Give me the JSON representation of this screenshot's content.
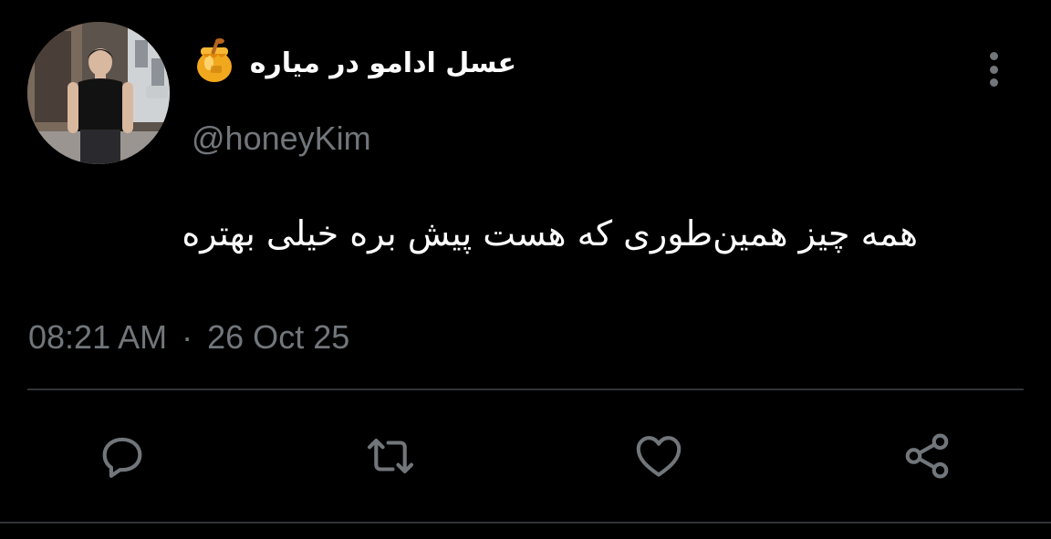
{
  "tweet": {
    "display_name": "عسل ادامو در میاره",
    "name_emoji": "honey-pot-icon",
    "handle": "@honeyKim",
    "text": "همه چیز همین‌طوری که هست پیش بره خیلی بهتره",
    "time": "08:21 AM",
    "separator": "·",
    "date": "26 Oct 25"
  },
  "actions": {
    "reply": "reply-icon",
    "retweet": "retweet-icon",
    "like": "heart-icon",
    "share": "share-icon"
  },
  "colors": {
    "background": "#000000",
    "primary_text": "#ffffff",
    "secondary_text": "#71767b",
    "divider": "#2f3336"
  }
}
